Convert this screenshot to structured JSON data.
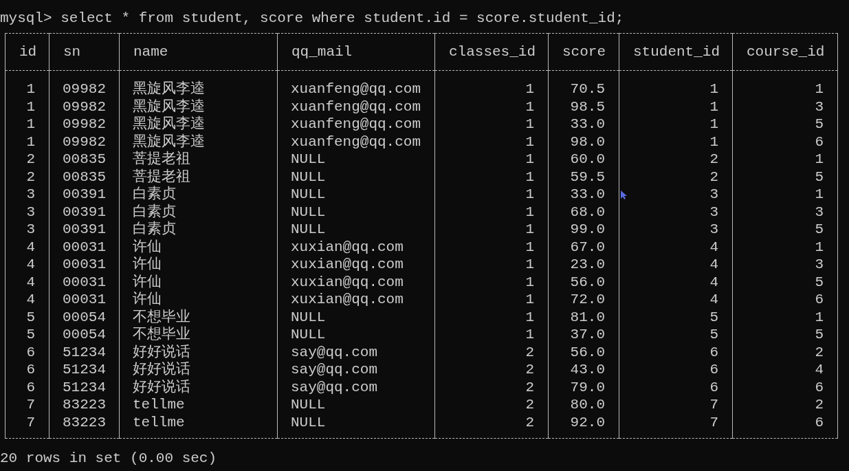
{
  "terminal": {
    "command_line": "mysql> select * from student, score where student.id = score.student_id;",
    "table": {
      "columns": [
        {
          "label": "id",
          "kind": "number"
        },
        {
          "label": "sn",
          "kind": "text"
        },
        {
          "label": "name",
          "kind": "text"
        },
        {
          "label": "qq_mail",
          "kind": "text"
        },
        {
          "label": "classes_id",
          "kind": "number"
        },
        {
          "label": "score",
          "kind": "number"
        },
        {
          "label": "student_id",
          "kind": "number"
        },
        {
          "label": "course_id",
          "kind": "number"
        }
      ],
      "rows": [
        [
          "1",
          "09982",
          "黑旋风李逵",
          "xuanfeng@qq.com",
          "1",
          "70.5",
          "1",
          "1"
        ],
        [
          "1",
          "09982",
          "黑旋风李逵",
          "xuanfeng@qq.com",
          "1",
          "98.5",
          "1",
          "3"
        ],
        [
          "1",
          "09982",
          "黑旋风李逵",
          "xuanfeng@qq.com",
          "1",
          "33.0",
          "1",
          "5"
        ],
        [
          "1",
          "09982",
          "黑旋风李逵",
          "xuanfeng@qq.com",
          "1",
          "98.0",
          "1",
          "6"
        ],
        [
          "2",
          "00835",
          "菩提老祖",
          "NULL",
          "1",
          "60.0",
          "2",
          "1"
        ],
        [
          "2",
          "00835",
          "菩提老祖",
          "NULL",
          "1",
          "59.5",
          "2",
          "5"
        ],
        [
          "3",
          "00391",
          "白素贞",
          "NULL",
          "1",
          "33.0",
          "3",
          "1"
        ],
        [
          "3",
          "00391",
          "白素贞",
          "NULL",
          "1",
          "68.0",
          "3",
          "3"
        ],
        [
          "3",
          "00391",
          "白素贞",
          "NULL",
          "1",
          "99.0",
          "3",
          "5"
        ],
        [
          "4",
          "00031",
          "许仙",
          "xuxian@qq.com",
          "1",
          "67.0",
          "4",
          "1"
        ],
        [
          "4",
          "00031",
          "许仙",
          "xuxian@qq.com",
          "1",
          "23.0",
          "4",
          "3"
        ],
        [
          "4",
          "00031",
          "许仙",
          "xuxian@qq.com",
          "1",
          "56.0",
          "4",
          "5"
        ],
        [
          "4",
          "00031",
          "许仙",
          "xuxian@qq.com",
          "1",
          "72.0",
          "4",
          "6"
        ],
        [
          "5",
          "00054",
          "不想毕业",
          "NULL",
          "1",
          "81.0",
          "5",
          "1"
        ],
        [
          "5",
          "00054",
          "不想毕业",
          "NULL",
          "1",
          "37.0",
          "5",
          "5"
        ],
        [
          "6",
          "51234",
          "好好说话",
          "say@qq.com",
          "2",
          "56.0",
          "6",
          "2"
        ],
        [
          "6",
          "51234",
          "好好说话",
          "say@qq.com",
          "2",
          "43.0",
          "6",
          "4"
        ],
        [
          "6",
          "51234",
          "好好说话",
          "say@qq.com",
          "2",
          "79.0",
          "6",
          "6"
        ],
        [
          "7",
          "83223",
          "tellme",
          "NULL",
          "2",
          "80.0",
          "7",
          "2"
        ],
        [
          "7",
          "83223",
          "tellme",
          "NULL",
          "2",
          "92.0",
          "7",
          "6"
        ]
      ]
    },
    "result_summary": "20 rows in set (0.00 sec)"
  }
}
